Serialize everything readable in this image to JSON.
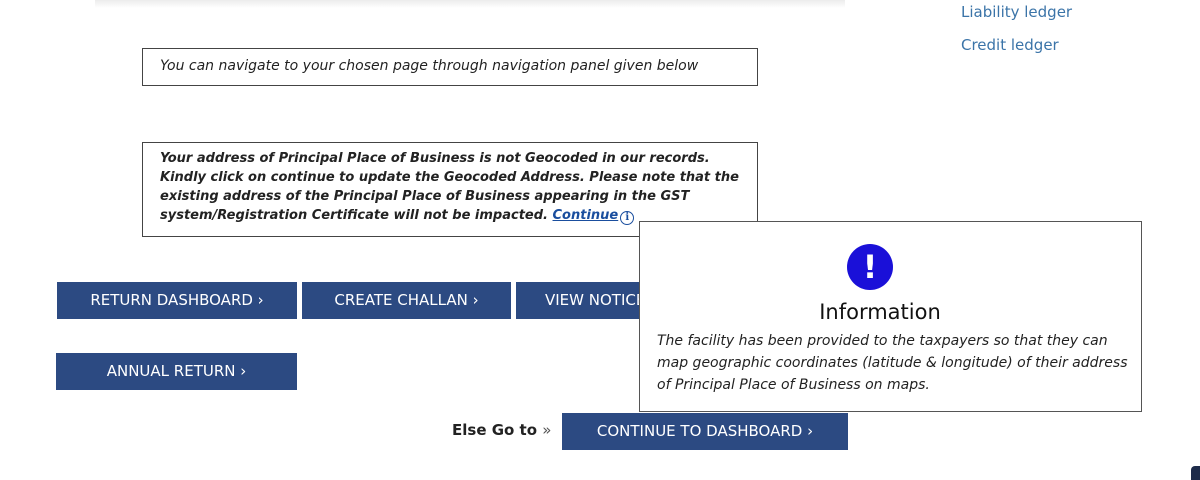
{
  "side_links": {
    "liability": "Liability ledger",
    "credit": "Credit ledger"
  },
  "nav_notice": "You can navigate to your chosen page through navigation panel given below",
  "geocode_notice": {
    "text": "Your address of Principal Place of Business is not Geocoded in our records. Kindly click on continue to update the Geocoded Address. Please note that the existing address of the Principal Place of Business appearing in the GST system/Registration Certificate will not be impacted.",
    "link": "Continue",
    "info_icon": "i"
  },
  "buttons": {
    "return_dashboard": "RETURN DASHBOARD ›",
    "create_challan": "CREATE CHALLAN ›",
    "view_notices": "VIEW NOTICES ›",
    "annual_return": "ANNUAL RETURN ›",
    "continue_dashboard": "CONTINUE TO DASHBOARD ›"
  },
  "else_go": {
    "label": "Else Go to",
    "arrow": "»"
  },
  "popup": {
    "icon": "!",
    "title": "Information",
    "text": "The facility has been provided to the taxpayers so that they can map geographic coordinates (latitude & longitude) of their address of Principal Place of Business on maps."
  },
  "colors": {
    "button_bg": "#2c4a82",
    "link": "#1a4e9e",
    "side_link": "#3b74a8",
    "popup_icon": "#1a10d8"
  }
}
